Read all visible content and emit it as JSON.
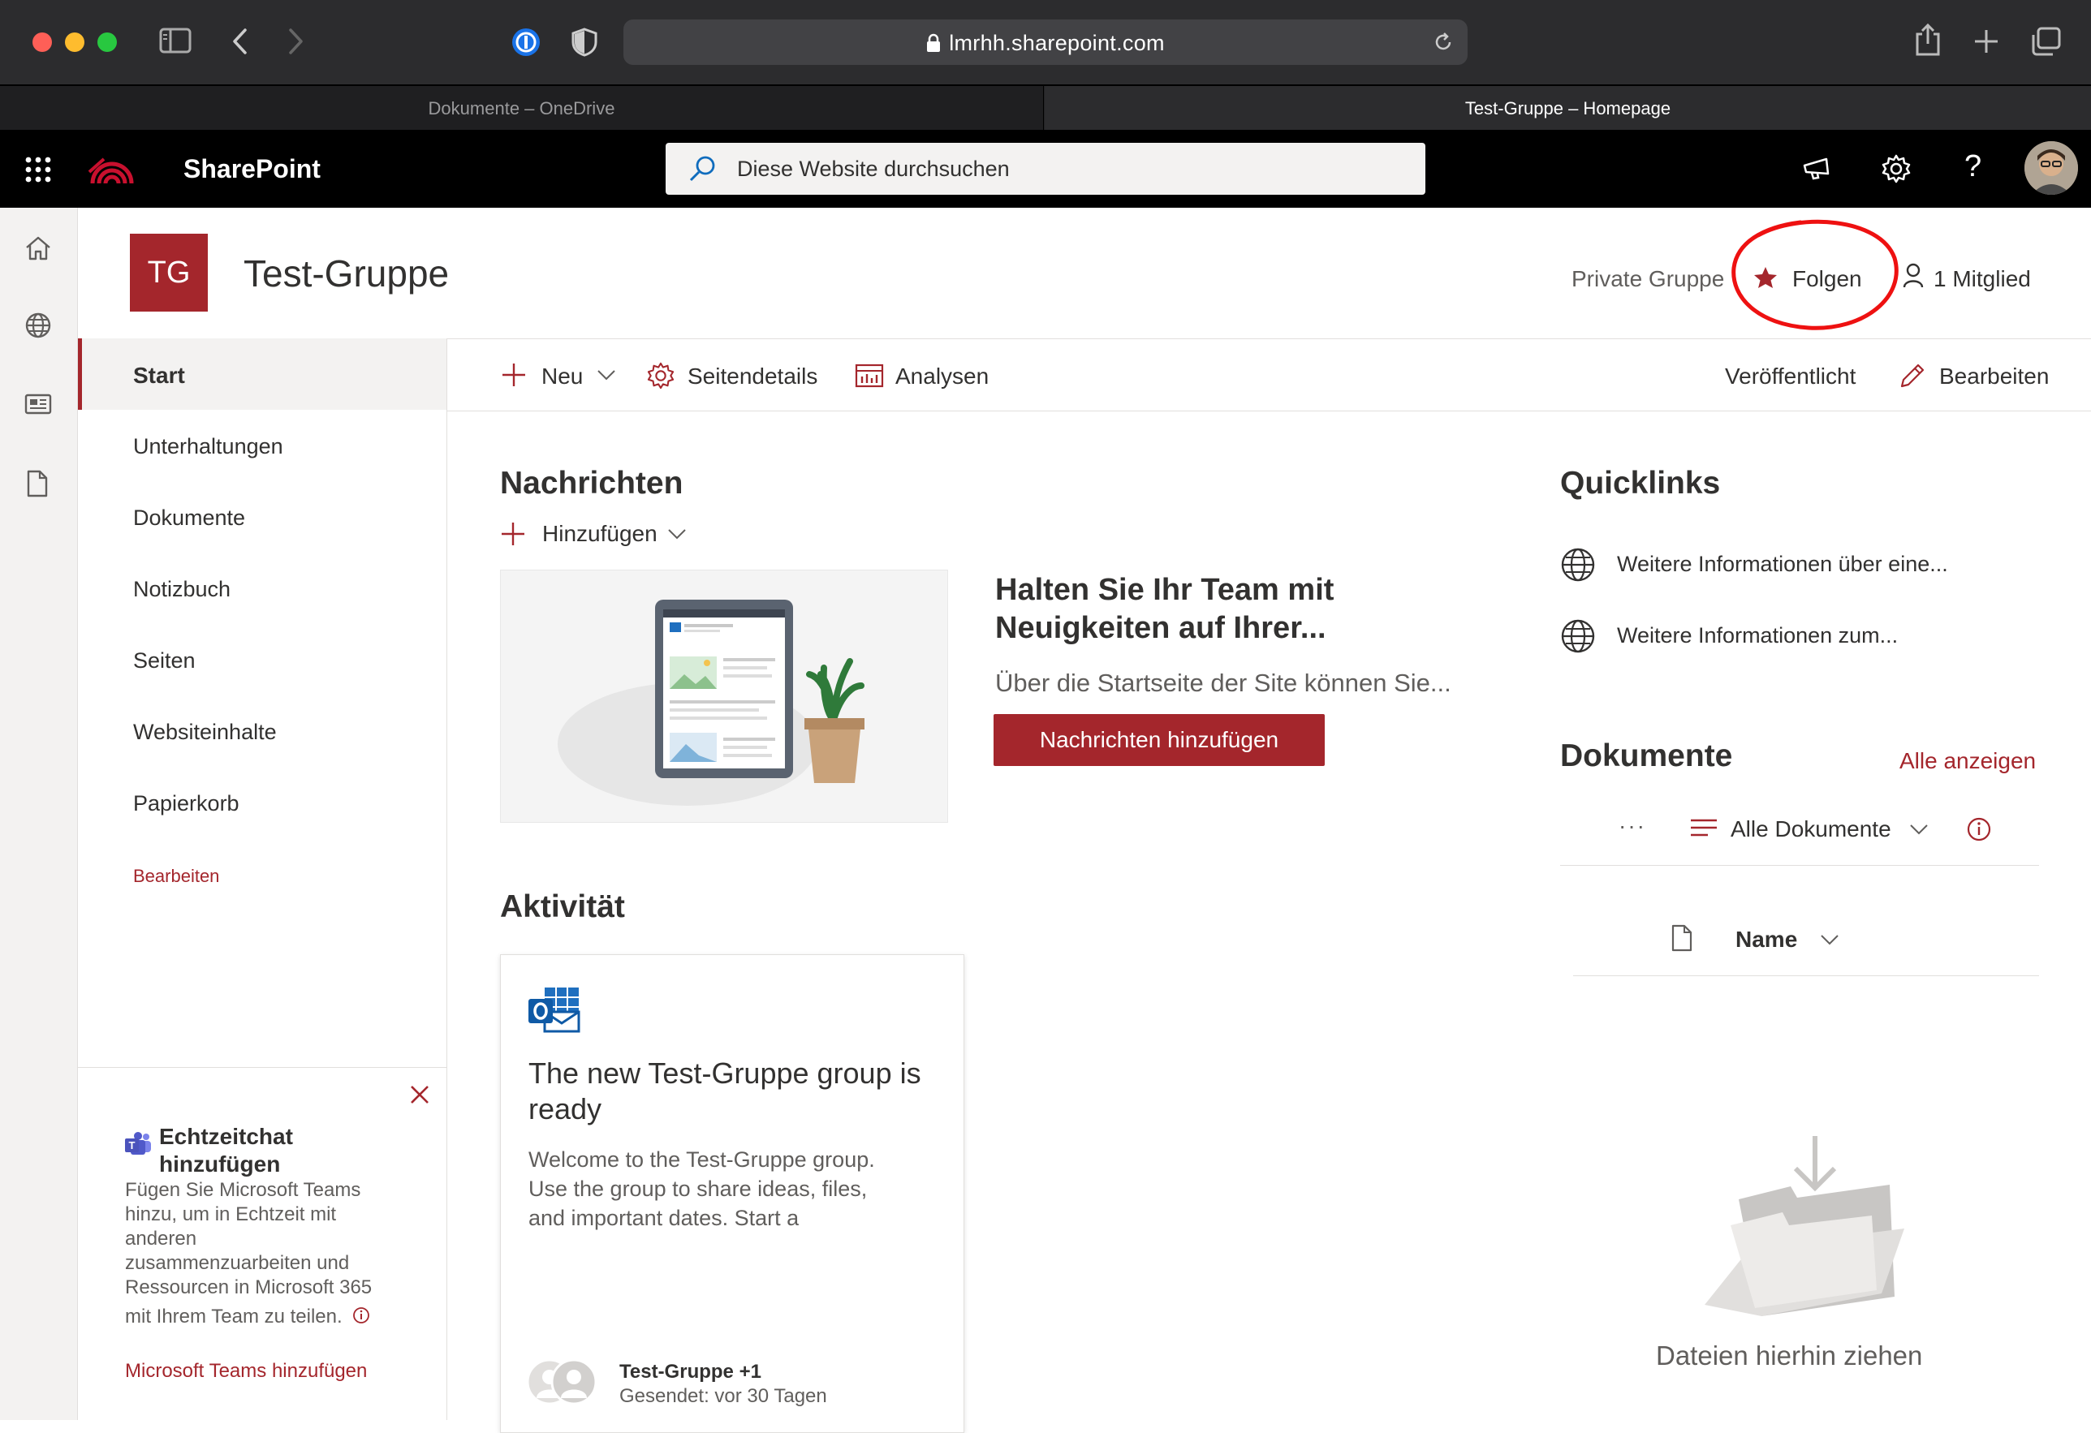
{
  "browser": {
    "url": "lmrhh.sharepoint.com",
    "tabs": [
      {
        "label": "Dokumente – OneDrive",
        "active": false
      },
      {
        "label": "Test-Gruppe – Homepage",
        "active": true
      }
    ]
  },
  "suite": {
    "app_name": "SharePoint",
    "search_placeholder": "Diese Website durchsuchen"
  },
  "site": {
    "logo_initials": "TG",
    "title": "Test-Gruppe",
    "privacy": "Private Gruppe",
    "follow_label": "Folgen",
    "members_label": "1 Mitglied"
  },
  "leftnav": {
    "items": [
      {
        "label": "Start",
        "selected": true
      },
      {
        "label": "Unterhaltungen"
      },
      {
        "label": "Dokumente"
      },
      {
        "label": "Notizbuch"
      },
      {
        "label": "Seiten"
      },
      {
        "label": "Websiteinhalte"
      },
      {
        "label": "Papierkorb"
      }
    ],
    "edit_label": "Bearbeiten"
  },
  "teams_promo": {
    "title_line1": "Echtzeitchat",
    "title_line2": "hinzufügen",
    "body_lines": [
      "Fügen Sie Microsoft Teams",
      "hinzu, um in Echtzeit mit",
      "anderen",
      "zusammenzuarbeiten und",
      "Ressourcen in Microsoft 365",
      "mit Ihrem Team zu teilen."
    ],
    "link": "Microsoft Teams hinzufügen"
  },
  "commandbar": {
    "new_label": "Neu",
    "page_details_label": "Seitendetails",
    "analytics_label": "Analysen",
    "status_label": "Veröffentlicht",
    "edit_label": "Bearbeiten"
  },
  "news": {
    "heading": "Nachrichten",
    "add_label": "Hinzufügen",
    "card_title_line1": "Halten Sie Ihr Team mit",
    "card_title_line2": "Neuigkeiten auf Ihrer...",
    "card_desc": "Über die Startseite der Site können Sie...",
    "add_news_button": "Nachrichten hinzufügen"
  },
  "activity": {
    "heading": "Aktivität",
    "card_title_line1": "The new Test-Gruppe group is",
    "card_title_line2": "ready",
    "card_body_lines": [
      "Welcome to the Test-Gruppe group.",
      "Use the group to share ideas, files,",
      "and important dates. Start a"
    ],
    "sender": "Test-Gruppe +1",
    "sent": "Gesendet: vor 30 Tagen"
  },
  "quicklinks": {
    "heading": "Quicklinks",
    "items": [
      {
        "label": "Weitere Informationen über eine..."
      },
      {
        "label": "Weitere Informationen zum..."
      }
    ]
  },
  "documents": {
    "heading": "Dokumente",
    "see_all": "Alle anzeigen",
    "more": "···",
    "view_label": "Alle Dokumente",
    "col_name": "Name",
    "drop_text": "Dateien hierhin ziehen"
  },
  "colors": {
    "accent": "#a4262c",
    "suite_bg": "#000000"
  }
}
